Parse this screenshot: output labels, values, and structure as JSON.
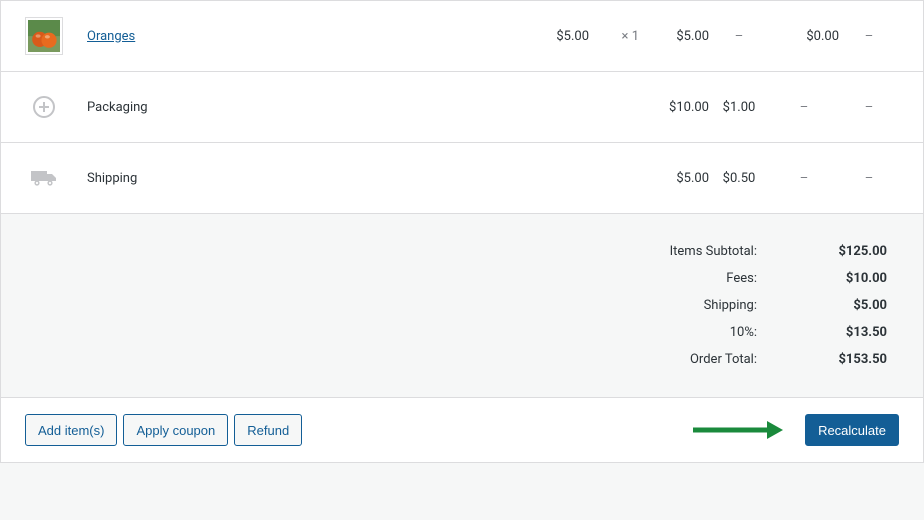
{
  "items": [
    {
      "name": "Oranges",
      "cost": "$5.00",
      "qty": "× 1",
      "total": "$5.00",
      "col1": "–",
      "col2": "$0.00",
      "col3": "–"
    }
  ],
  "fees": [
    {
      "name": "Packaging",
      "total": "$10.00",
      "tax": "$1.00",
      "col1": "–",
      "col2": "–"
    }
  ],
  "shipping": [
    {
      "name": "Shipping",
      "total": "$5.00",
      "tax": "$0.50",
      "col1": "–",
      "col2": "–"
    }
  ],
  "totals": {
    "subtotal_label": "Items Subtotal:",
    "subtotal_value": "$125.00",
    "fees_label": "Fees:",
    "fees_value": "$10.00",
    "shipping_label": "Shipping:",
    "shipping_value": "$5.00",
    "tax_label": "10%:",
    "tax_value": "$13.50",
    "order_total_label": "Order Total:",
    "order_total_value": "$153.50"
  },
  "actions": {
    "add_items": "Add item(s)",
    "apply_coupon": "Apply coupon",
    "refund": "Refund",
    "recalculate": "Recalculate"
  }
}
